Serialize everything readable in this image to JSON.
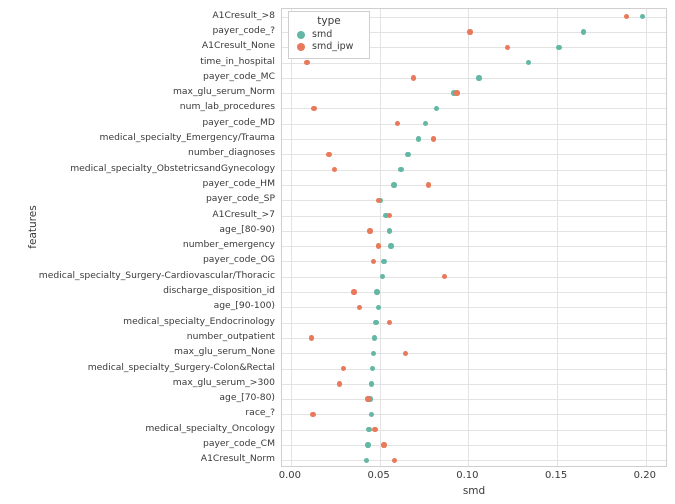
{
  "chart_data": {
    "type": "scatter",
    "title": "",
    "xlabel": "smd",
    "ylabel": "features",
    "xlim": [
      -0.005,
      0.2125
    ],
    "xticks": [
      0.0,
      0.05,
      0.1,
      0.15,
      0.2
    ],
    "xticklabels": [
      "0.00",
      "0.05",
      "0.10",
      "0.15",
      "0.20"
    ],
    "grid": true,
    "legend": {
      "title": "type",
      "position": "top-left-inside",
      "entries": [
        {
          "name": "smd",
          "color": "#63b7a4"
        },
        {
          "name": "smd_ipw",
          "color": "#e8795a"
        }
      ]
    },
    "categories": [
      "A1Cresult_>8",
      "payer_code_?",
      "A1Cresult_None",
      "time_in_hospital",
      "payer_code_MC",
      "max_glu_serum_Norm",
      "num_lab_procedures",
      "payer_code_MD",
      "medical_specialty_Emergency/Trauma",
      "number_diagnoses",
      "medical_specialty_ObstetricsandGynecology",
      "payer_code_HM",
      "payer_code_SP",
      "A1Cresult_>7",
      "age_[80-90)",
      "number_emergency",
      "payer_code_OG",
      "medical_specialty_Surgery-Cardiovascular/Thoracic",
      "discharge_disposition_id",
      "age_[90-100)",
      "medical_specialty_Endocrinology",
      "number_outpatient",
      "max_glu_serum_None",
      "medical_specialty_Surgery-Colon&Rectal",
      "max_glu_serum_>300",
      "age_[70-80)",
      "race_?",
      "medical_specialty_Oncology",
      "payer_code_CM",
      "A1Cresult_Norm"
    ],
    "series": [
      {
        "name": "smd",
        "color": "#63b7a4",
        "values": [
          0.198,
          0.165,
          0.151,
          0.134,
          0.106,
          0.092,
          0.082,
          0.076,
          0.072,
          0.066,
          0.062,
          0.058,
          0.0505,
          0.0535,
          0.0555,
          0.0565,
          0.0525,
          0.0515,
          0.0485,
          0.0495,
          0.048,
          0.047,
          0.0465,
          0.046,
          0.0455,
          0.0445,
          0.0455,
          0.044,
          0.0435,
          0.0425
        ]
      },
      {
        "name": "smd_ipw",
        "color": "#e8795a",
        "values": [
          0.189,
          0.101,
          0.122,
          0.009,
          0.069,
          0.0935,
          0.013,
          0.06,
          0.0805,
          0.0215,
          0.0245,
          0.0775,
          0.0495,
          0.0555,
          0.0445,
          0.0495,
          0.0465,
          0.0865,
          0.0355,
          0.0385,
          0.0555,
          0.0115,
          0.0645,
          0.0295,
          0.0275,
          0.0435,
          0.0125,
          0.0475,
          0.0525,
          0.0585
        ]
      }
    ]
  }
}
